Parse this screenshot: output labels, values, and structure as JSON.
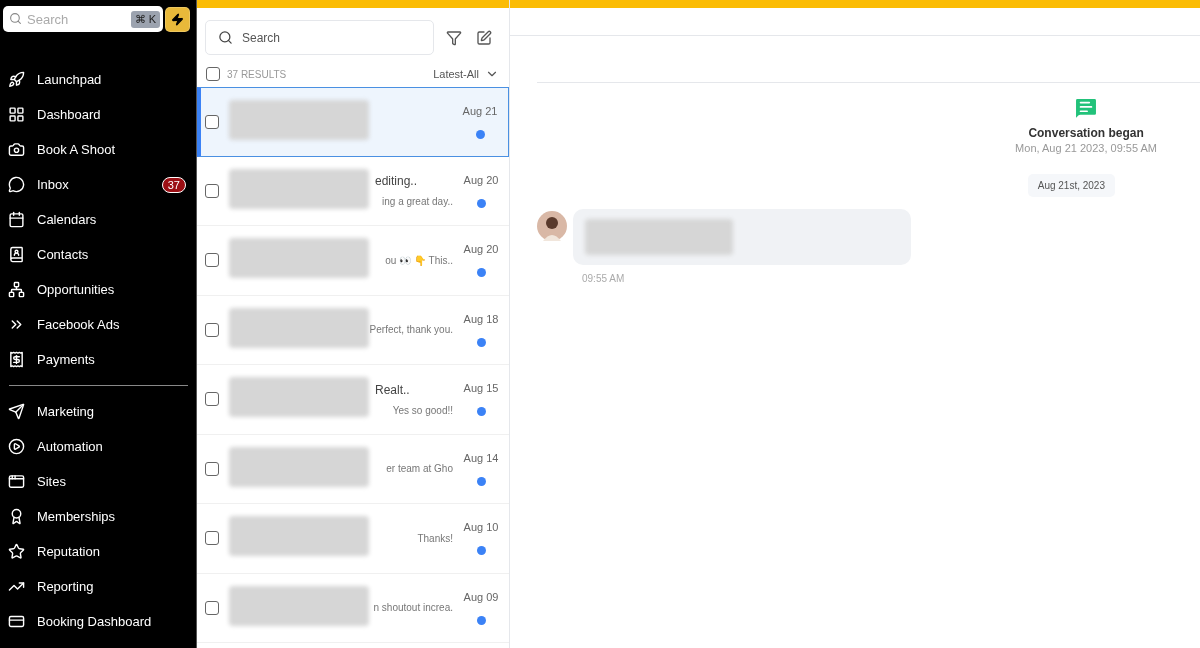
{
  "sidebar": {
    "search": {
      "placeholder": "Search",
      "shortcut": "⌘ K"
    },
    "items": [
      {
        "label": "Launchpad"
      },
      {
        "label": "Dashboard"
      },
      {
        "label": "Book A Shoot"
      },
      {
        "label": "Inbox",
        "badge": "37"
      },
      {
        "label": "Calendars"
      },
      {
        "label": "Contacts"
      },
      {
        "label": "Opportunities"
      },
      {
        "label": "Facebook Ads"
      },
      {
        "label": "Payments"
      }
    ],
    "items_2": [
      {
        "label": "Marketing"
      },
      {
        "label": "Automation"
      },
      {
        "label": "Sites"
      },
      {
        "label": "Memberships"
      },
      {
        "label": "Reputation"
      },
      {
        "label": "Reporting"
      },
      {
        "label": "Booking Dashboard"
      }
    ]
  },
  "conversations": {
    "search": {
      "placeholder": "Search"
    },
    "results": "37 RESULTS",
    "select_all_checked": false,
    "sort": "Latest-All",
    "rows": [
      {
        "title": "",
        "preview": "",
        "date": "Aug 21",
        "selected": true,
        "checked": false,
        "unread": true
      },
      {
        "title": "editing..",
        "preview": "ing a great day..",
        "date": "Aug 20",
        "selected": false,
        "checked": false,
        "unread": true
      },
      {
        "title": "",
        "preview": "ou 👀 👇 This..",
        "date": "Aug 20",
        "selected": false,
        "checked": false,
        "unread": true
      },
      {
        "title": "",
        "preview": "Perfect, thank you.",
        "date": "Aug 18",
        "selected": false,
        "checked": false,
        "unread": true
      },
      {
        "title": "Realt..",
        "preview": "Yes so good!!",
        "date": "Aug 15",
        "selected": false,
        "checked": false,
        "unread": true
      },
      {
        "title": "",
        "preview": "er team at Gho",
        "date": "Aug 14",
        "selected": false,
        "checked": false,
        "unread": true
      },
      {
        "title": "",
        "preview": "Thanks!",
        "date": "Aug 10",
        "selected": false,
        "checked": false,
        "unread": true
      },
      {
        "title": "",
        "preview": "n shoutout increa.",
        "date": "Aug 09",
        "selected": false,
        "checked": false,
        "unread": true
      }
    ]
  },
  "chat": {
    "event": {
      "title": "Conversation began",
      "time": "Mon, Aug 21 2023, 09:55 AM"
    },
    "date_chip": "Aug 21st, 2023",
    "messages": [
      {
        "time": "09:55 AM"
      }
    ]
  }
}
